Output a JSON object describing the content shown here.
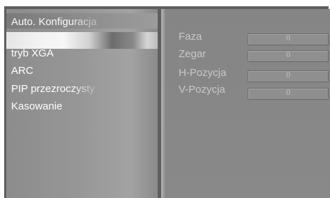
{
  "menu": {
    "title": "Auto. Konfiguracja",
    "items": [
      {
        "label": "tryb XGA"
      },
      {
        "label": "ARC"
      },
      {
        "label": "PIP przezroczysty"
      },
      {
        "label": "Kasowanie"
      }
    ]
  },
  "settings": {
    "rows": [
      {
        "label": "Faza",
        "value": "0"
      },
      {
        "label": "Zegar",
        "value": "0"
      },
      {
        "label": "H-Pozycja",
        "value": "0"
      },
      {
        "label": "V-Pozycja",
        "value": "0"
      }
    ]
  }
}
